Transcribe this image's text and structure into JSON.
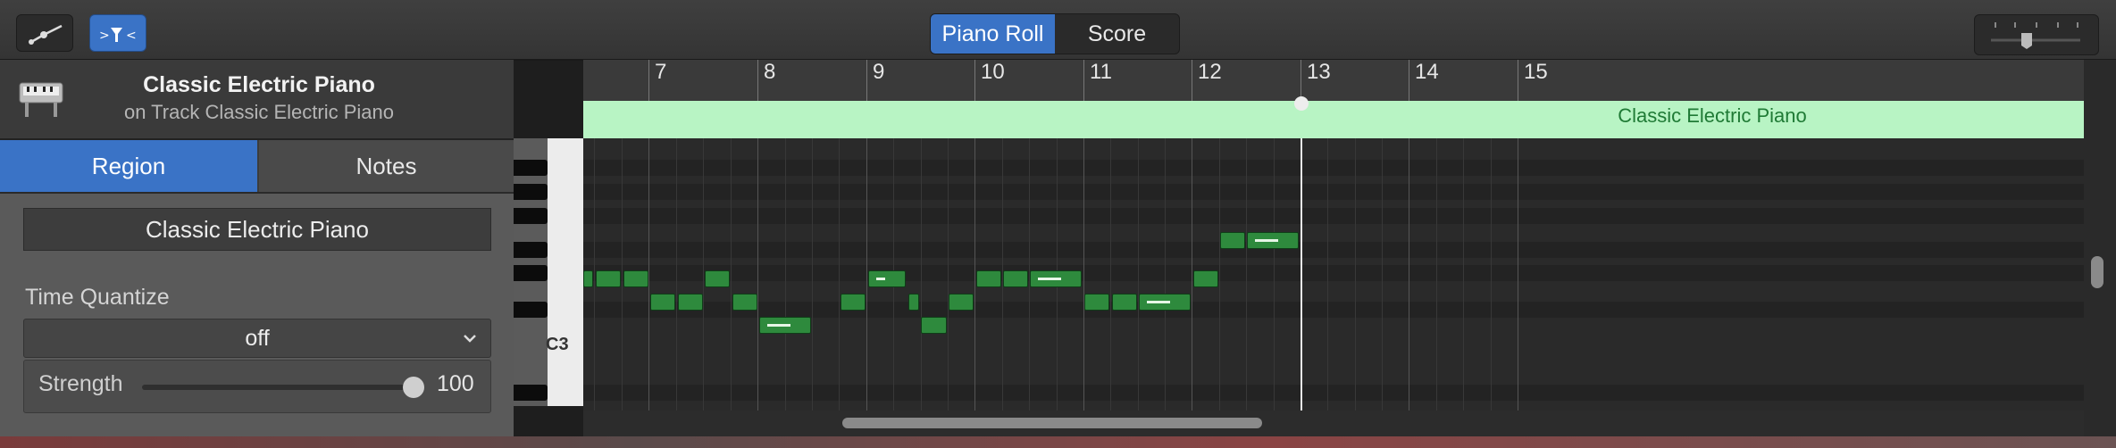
{
  "toolbar": {
    "automation_icon": "automation-curve-icon",
    "midi_filter_icon": "midi-in-filter-icon",
    "view_tabs": [
      {
        "label": "Piano Roll",
        "active": true
      },
      {
        "label": "Score",
        "active": false
      }
    ],
    "zoom_icon": "zoom-slider-icon"
  },
  "track": {
    "icon": "electric-piano-icon",
    "title": "Classic Electric Piano",
    "subtitle": "on Track Classic Electric Piano"
  },
  "inspector": {
    "tabs": [
      {
        "label": "Region",
        "active": true
      },
      {
        "label": "Notes",
        "active": false
      }
    ],
    "region_name": "Classic Electric Piano",
    "time_quantize_label": "Time Quantize",
    "time_quantize_value": "off",
    "strength_label": "Strength",
    "strength_value": "100"
  },
  "keyboard": {
    "octave_label": "C3"
  },
  "ruler": {
    "bars": [
      "7",
      "8",
      "9",
      "10",
      "11",
      "12",
      "13",
      "14",
      "15"
    ]
  },
  "region": {
    "label": "Classic Electric Piano",
    "color": "#b8f4c4"
  },
  "colors": {
    "accent": "#3a73c6",
    "note": "#2e8a3d",
    "region": "#b8f4c4"
  }
}
